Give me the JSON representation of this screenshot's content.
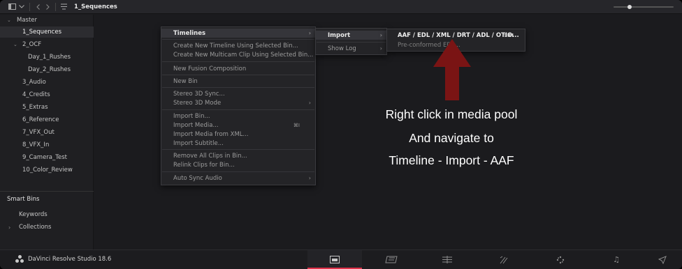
{
  "topbar": {
    "title": "1_Sequences",
    "icons": [
      "sidebar-toggle-icon",
      "chevron-down-icon",
      "back-icon",
      "forward-icon",
      "bin-view-icon"
    ]
  },
  "sidebar": {
    "master_label": "Master",
    "bins": [
      {
        "label": "1_Sequences",
        "selected": true
      },
      {
        "label": "2_OCF",
        "expanded": true
      },
      {
        "label": "Day_1_Rushes"
      },
      {
        "label": "Day_2_Rushes"
      },
      {
        "label": "3_Audio"
      },
      {
        "label": "4_Credits"
      },
      {
        "label": "5_Extras"
      },
      {
        "label": "6_Reference"
      },
      {
        "label": "7_VFX_Out"
      },
      {
        "label": "8_VFX_In"
      },
      {
        "label": "9_Camera_Test"
      },
      {
        "label": "10_Color_Review"
      }
    ],
    "smart_bins_label": "Smart Bins",
    "smart_items": [
      "Keywords",
      "Collections"
    ]
  },
  "context_menu": {
    "items": [
      {
        "label": "Timelines",
        "submenu": true,
        "highlighted": true
      },
      {
        "label": "Create New Timeline Using Selected Bin..."
      },
      {
        "label": "Create New Multicam Clip Using Selected Bin..."
      },
      {
        "label": "New Fusion Composition"
      },
      {
        "label": "New Bin"
      },
      {
        "label": "Stereo 3D Sync..."
      },
      {
        "label": "Stereo 3D Mode",
        "submenu": true
      },
      {
        "label": "Import Bin..."
      },
      {
        "label": "Import Media...",
        "shortcut": "⌘I"
      },
      {
        "label": "Import Media from XML..."
      },
      {
        "label": "Import Subtitle..."
      },
      {
        "label": "Remove All Clips in Bin..."
      },
      {
        "label": "Relink Clips for Bin..."
      },
      {
        "label": "Auto Sync Audio",
        "submenu": true
      }
    ]
  },
  "timelines_submenu": {
    "items": [
      {
        "label": "Import",
        "submenu": true,
        "highlighted": true
      },
      {
        "label": "Show Log",
        "submenu": true
      }
    ]
  },
  "import_submenu": {
    "items": [
      {
        "label": "AAF / EDL / XML / DRT / ADL / OTIO...",
        "shortcut": "⇧⌘I"
      },
      {
        "label": "Pre-conformed EDL..."
      }
    ]
  },
  "annotation": {
    "lines": [
      "Right click in media pool",
      "And navigate to",
      "Timeline - Import - AAF"
    ],
    "arrow_color": "#7a1414"
  },
  "bottombar": {
    "app_name": "DaVinci Resolve Studio 18.6",
    "pages": [
      "media-page-icon",
      "cut-page-icon",
      "edit-page-icon",
      "fusion-page-icon",
      "color-page-icon",
      "fairlight-page-icon",
      "deliver-page-icon"
    ],
    "active_page": 0,
    "accent": "#e0324a"
  }
}
